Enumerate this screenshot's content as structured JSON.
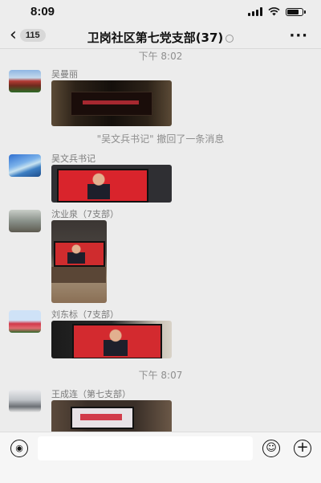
{
  "status": {
    "time": "8:09"
  },
  "nav": {
    "back_count": "115",
    "title": "卫岗社区第七党支部(37)"
  },
  "messages": {
    "ts1": "下午 8:02",
    "m1_sender": "吴曼丽",
    "recall": "\"吴文兵书记\" 撤回了一条消息",
    "m2_sender": "吴文兵书记",
    "m3_sender": "沈业泉（7支部）",
    "m4_sender": "刘东标（7支部）",
    "ts2": "下午 8:07",
    "m5_sender": "王成连（第七支部）"
  },
  "icons": {
    "back": "chevron-left-icon",
    "more": "more-dots-icon",
    "voice": "voice-icon",
    "emoji": "emoji-icon",
    "plus": "plus-icon"
  }
}
